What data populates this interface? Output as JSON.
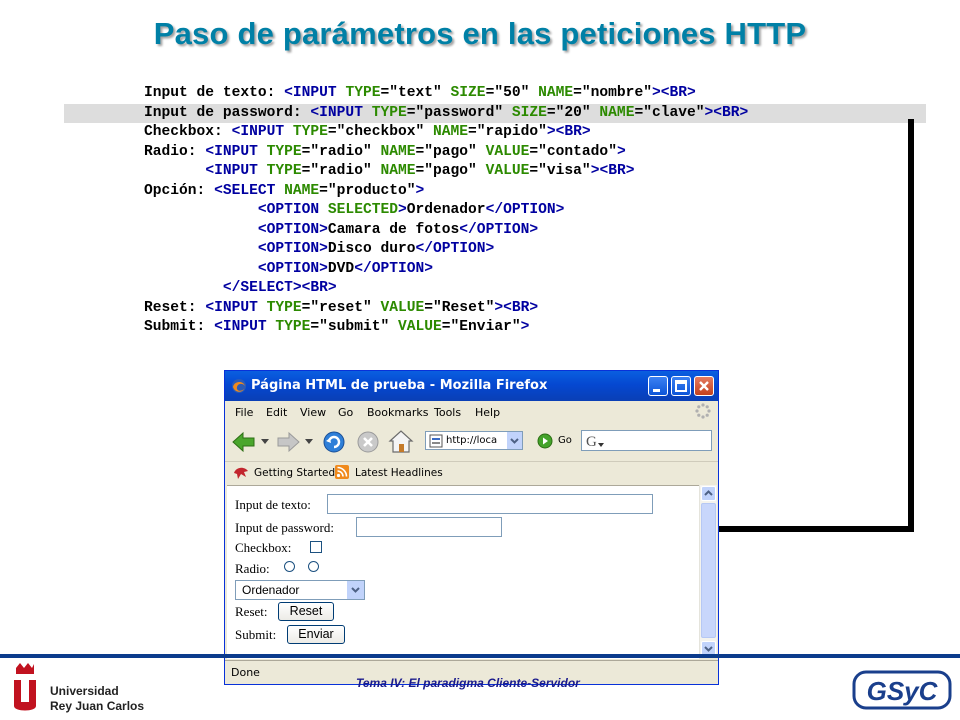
{
  "slide": {
    "title": "Paso de parámetros en las peticiones HTTP",
    "footer_caption": "Tema IV: El paradigma Cliente-Servidor",
    "university": [
      "Universidad",
      "Rey Juan Carlos"
    ],
    "group_logo": "GSyC"
  },
  "code_lines": [
    {
      "label": "Input de texto: ",
      "tokens": [
        [
          "b",
          "<INPUT "
        ],
        [
          "g",
          "TYPE"
        ],
        [
          "k",
          "=\"text\" "
        ],
        [
          "g",
          "SIZE"
        ],
        [
          "k",
          "=\"50\" "
        ],
        [
          "g",
          "NAME"
        ],
        [
          "k",
          "=\"nombre\""
        ],
        [
          "b",
          "><BR>"
        ]
      ]
    },
    {
      "label": "Input de password: ",
      "tokens": [
        [
          "b",
          "<INPUT "
        ],
        [
          "g",
          "TYPE"
        ],
        [
          "k",
          "=\"password\" "
        ],
        [
          "g",
          "SIZE"
        ],
        [
          "k",
          "=\"20\" "
        ],
        [
          "g",
          "NAME"
        ],
        [
          "k",
          "=\"clave\""
        ],
        [
          "b",
          "><BR>"
        ]
      ]
    },
    {
      "label": "Checkbox: ",
      "tokens": [
        [
          "b",
          "<INPUT "
        ],
        [
          "g",
          "TYPE"
        ],
        [
          "k",
          "=\"checkbox\" "
        ],
        [
          "g",
          "NAME"
        ],
        [
          "k",
          "=\"rapido\""
        ],
        [
          "b",
          "><BR>"
        ]
      ]
    },
    {
      "label": "Radio: ",
      "tokens": [
        [
          "b",
          "<INPUT "
        ],
        [
          "g",
          "TYPE"
        ],
        [
          "k",
          "=\"radio\" "
        ],
        [
          "g",
          "NAME"
        ],
        [
          "k",
          "=\"pago\" "
        ],
        [
          "g",
          "VALUE"
        ],
        [
          "k",
          "=\"contado\""
        ],
        [
          "b",
          ">"
        ]
      ]
    },
    {
      "label": "       ",
      "tokens": [
        [
          "b",
          "<INPUT "
        ],
        [
          "g",
          "TYPE"
        ],
        [
          "k",
          "=\"radio\" "
        ],
        [
          "g",
          "NAME"
        ],
        [
          "k",
          "=\"pago\" "
        ],
        [
          "g",
          "VALUE"
        ],
        [
          "k",
          "=\"visa\""
        ],
        [
          "b",
          "><BR>"
        ]
      ]
    },
    {
      "label": "Opción: ",
      "tokens": [
        [
          "b",
          "<SELECT "
        ],
        [
          "g",
          "NAME"
        ],
        [
          "k",
          "=\"producto\""
        ],
        [
          "b",
          ">"
        ]
      ]
    },
    {
      "label": "             ",
      "tokens": [
        [
          "b",
          "<OPTION "
        ],
        [
          "g",
          "SELECTED"
        ],
        [
          "b",
          ">"
        ],
        [
          "k",
          "Ordenador"
        ],
        [
          "b",
          "</OPTION>"
        ]
      ]
    },
    {
      "label": "             ",
      "tokens": [
        [
          "b",
          "<OPTION>"
        ],
        [
          "k",
          "Camara de fotos"
        ],
        [
          "b",
          "</OPTION>"
        ]
      ]
    },
    {
      "label": "             ",
      "tokens": [
        [
          "b",
          "<OPTION>"
        ],
        [
          "k",
          "Disco duro"
        ],
        [
          "b",
          "</OPTION>"
        ]
      ]
    },
    {
      "label": "             ",
      "tokens": [
        [
          "b",
          "<OPTION>"
        ],
        [
          "k",
          "DVD"
        ],
        [
          "b",
          "</OPTION>"
        ]
      ]
    },
    {
      "label": "         ",
      "tokens": [
        [
          "b",
          "</SELECT><BR>"
        ]
      ]
    },
    {
      "label": "Reset: ",
      "tokens": [
        [
          "b",
          "<INPUT "
        ],
        [
          "g",
          "TYPE"
        ],
        [
          "k",
          "=\"reset\" "
        ],
        [
          "g",
          "VALUE"
        ],
        [
          "k",
          "=\"Reset\""
        ],
        [
          "b",
          "><BR>"
        ]
      ]
    },
    {
      "label": "Submit: ",
      "tokens": [
        [
          "b",
          "<INPUT "
        ],
        [
          "g",
          "TYPE"
        ],
        [
          "k",
          "=\"submit\" "
        ],
        [
          "g",
          "VALUE"
        ],
        [
          "k",
          "=\"Enviar\""
        ],
        [
          "b",
          ">"
        ]
      ]
    }
  ],
  "highlighted_line": 1,
  "browser": {
    "title": "Página HTML de prueba - Mozilla Firefox",
    "menu": [
      "File",
      "Edit",
      "View",
      "Go",
      "Bookmarks",
      "Tools",
      "Help"
    ],
    "url": "http://localhost",
    "go_label": "Go",
    "bookmarks": [
      "Getting Started",
      "Latest Headlines"
    ],
    "status": "Done",
    "form": {
      "text_label": "Input de texto:",
      "password_label": "Input de password:",
      "checkbox_label": "Checkbox:",
      "radio_label": "Radio:",
      "select_value": "Ordenador",
      "reset_label": "Reset:",
      "reset_button": "Reset",
      "submit_label": "Submit:",
      "submit_button": "Enviar"
    }
  },
  "colors": {
    "title": "#0080a6",
    "code_tag": "#0000a0",
    "code_attr": "#2c8a00",
    "highlight": "#dddddd",
    "footer_line": "#0b3b8c"
  }
}
